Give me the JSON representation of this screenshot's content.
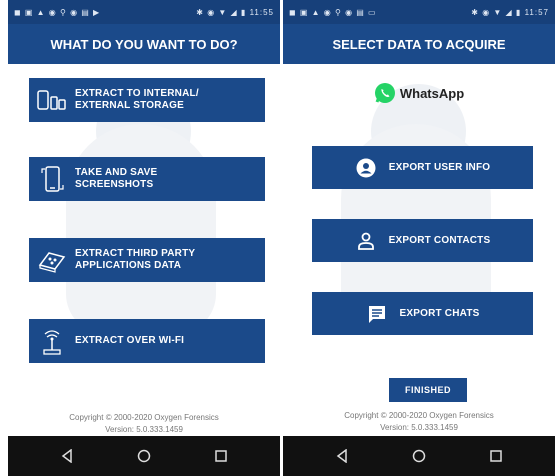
{
  "left_screen": {
    "status": {
      "left_icons": "◼ ▣ ▲ ◉ ⚲ ◉ ▤ ▶",
      "right_icons": "✱ ◉ ▼ ◢ ▮",
      "time": "11:55"
    },
    "title": "WHAT DO YOU WANT TO DO?",
    "actions": [
      {
        "line1": "EXTRACT TO INTERNAL/",
        "line2": "EXTERNAL STORAGE",
        "icon": "storage-devices-icon"
      },
      {
        "line1": "TAKE AND SAVE",
        "line2": "SCREENSHOTS",
        "icon": "phone-screenshot-icon"
      },
      {
        "line1": "EXTRACT THIRD PARTY",
        "line2": "APPLICATIONS DATA",
        "icon": "apps-data-icon"
      },
      {
        "line1": "EXTRACT OVER WI-FI",
        "line2": "",
        "icon": "wifi-tower-icon"
      }
    ],
    "copyright": "Copyright © 2000-2020 Oxygen Forensics",
    "version": "Version: 5.0.333.1459"
  },
  "right_screen": {
    "status": {
      "left_icons": "◼ ▣ ▲ ◉ ⚲ ◉ ▤ ▭",
      "right_icons": "✱ ◉ ▼ ◢ ▮",
      "time": "11:57"
    },
    "title": "SELECT DATA TO ACQUIRE",
    "app_name": "WhatsApp",
    "actions": [
      {
        "label": "EXPORT USER INFO",
        "icon": "user-circle-icon"
      },
      {
        "label": "EXPORT CONTACTS",
        "icon": "person-outline-icon"
      },
      {
        "label": "EXPORT CHATS",
        "icon": "chat-icon"
      }
    ],
    "finish_label": "FINISHED",
    "copyright": "Copyright © 2000-2020 Oxygen Forensics",
    "version": "Version: 5.0.333.1459"
  },
  "colors": {
    "primary": "#1b4a8a",
    "statusbar": "#17407a",
    "navbar": "#111111",
    "whatsapp": "#25d366"
  }
}
